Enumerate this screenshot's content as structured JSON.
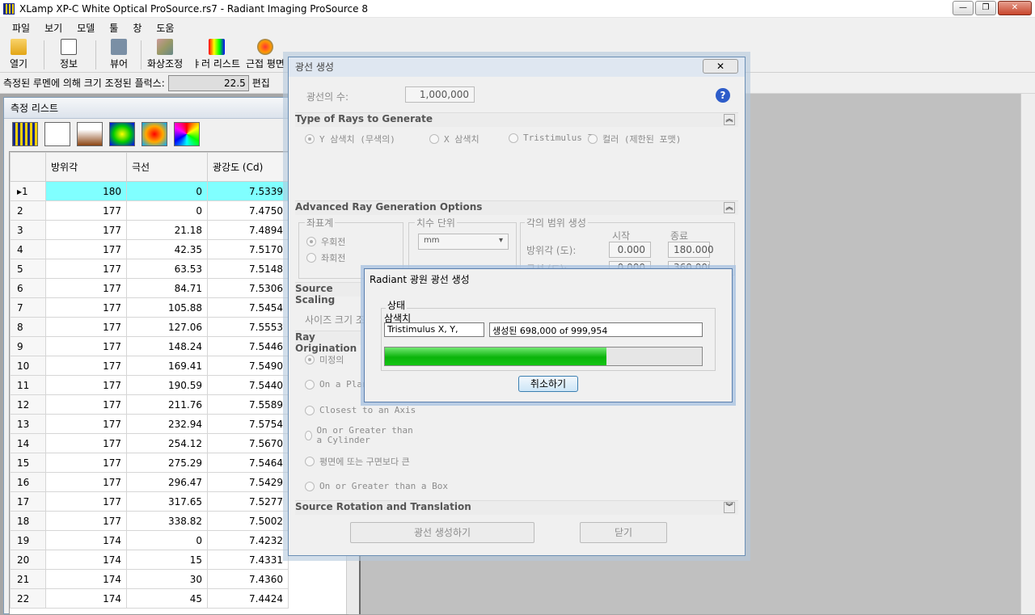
{
  "window": {
    "title": "XLamp XP-C White Optical ProSource.rs7 - Radiant Imaging ProSource 8"
  },
  "menu": [
    "파일",
    "보기",
    "모델",
    "툴",
    "창",
    "도움"
  ],
  "toolbar": [
    {
      "label": "열기",
      "icon": "folder-open-icon"
    },
    {
      "label": "정보",
      "icon": "info-doc-icon"
    },
    {
      "label": "뷰어",
      "icon": "viewer-icon"
    },
    {
      "label": "화상조정",
      "icon": "image-adjust-icon"
    },
    {
      "label": "ㅑ러 리스트",
      "icon": "color-list-icon"
    },
    {
      "label": "근접 평면",
      "icon": "near-field-icon"
    }
  ],
  "flux": {
    "label": "측정된 루멘에 의해 크기 조정된 플럭스:",
    "value": "22.5",
    "edit": "편집"
  },
  "measurement_list": {
    "caption": "측정 리스트",
    "columns": [
      "방위각",
      "극선",
      "광강도 (Cd)"
    ],
    "rows": [
      [
        "1",
        "180",
        "0",
        "7.5339"
      ],
      [
        "2",
        "177",
        "0",
        "7.4750"
      ],
      [
        "3",
        "177",
        "21.18",
        "7.4894"
      ],
      [
        "4",
        "177",
        "42.35",
        "7.5170"
      ],
      [
        "5",
        "177",
        "63.53",
        "7.5148"
      ],
      [
        "6",
        "177",
        "84.71",
        "7.5306"
      ],
      [
        "7",
        "177",
        "105.88",
        "7.5454"
      ],
      [
        "8",
        "177",
        "127.06",
        "7.5553"
      ],
      [
        "9",
        "177",
        "148.24",
        "7.5446"
      ],
      [
        "10",
        "177",
        "169.41",
        "7.5490"
      ],
      [
        "11",
        "177",
        "190.59",
        "7.5440"
      ],
      [
        "12",
        "177",
        "211.76",
        "7.5589"
      ],
      [
        "13",
        "177",
        "232.94",
        "7.5754"
      ],
      [
        "14",
        "177",
        "254.12",
        "7.5670"
      ],
      [
        "15",
        "177",
        "275.29",
        "7.5464"
      ],
      [
        "16",
        "177",
        "296.47",
        "7.5429"
      ],
      [
        "17",
        "177",
        "317.65",
        "7.5277"
      ],
      [
        "18",
        "177",
        "338.82",
        "7.5002"
      ],
      [
        "19",
        "174",
        "0",
        "7.4232"
      ],
      [
        "20",
        "174",
        "15",
        "7.4331"
      ],
      [
        "21",
        "174",
        "30",
        "7.4360"
      ],
      [
        "22",
        "174",
        "45",
        "7.4424"
      ]
    ]
  },
  "ray_dialog": {
    "title": "광선 생성",
    "close": "닫기",
    "num_rays_label": "광선의 수:",
    "num_rays": "1,000,000",
    "type_section": "Type of Rays to Generate",
    "types": [
      "Y 삼색치 (무색의)",
      "X 삼색치",
      "Tristimulus Z",
      "컬러 (제한된 포맷)"
    ],
    "adv_section": "Advanced Ray Generation Options",
    "coord_label": "좌표계",
    "coord_opts": [
      "우회전",
      "좌회전"
    ],
    "unit_label": "치수 단위",
    "unit_value": "mm",
    "angle_label": "각의 범위 생성",
    "angle_start": "시작",
    "angle_end": "종료",
    "azimuth_label": "방위각 (도):",
    "azimuth_start": "0.000",
    "azimuth_end": "180.000",
    "polar_label": "극선 (도):",
    "polar_start": "0.000",
    "polar_end": "360.000",
    "scaling_section": "Source Scaling",
    "size_label": "사이즈 크기 조",
    "origin_section": "Ray Origination",
    "origin_opts": [
      "미정의",
      "On a Plane",
      "Closest to an Axis",
      "On or Greater than a Cylinder",
      "평면에 또는 구면보다 큰",
      "On or Greater than a Box"
    ],
    "rotation_section": "Source Rotation and Translation",
    "generate_btn": "광선 생성하기",
    "close_btn": "닫기"
  },
  "progress_dialog": {
    "title": "Radiant 광원 광선 생성",
    "group": "상태",
    "sub": "삼색치",
    "field1": "Tristimulus X, Y,",
    "field2": "생성된 698,000 of 999,954",
    "progress": 0.698,
    "cancel": "취소하기"
  }
}
